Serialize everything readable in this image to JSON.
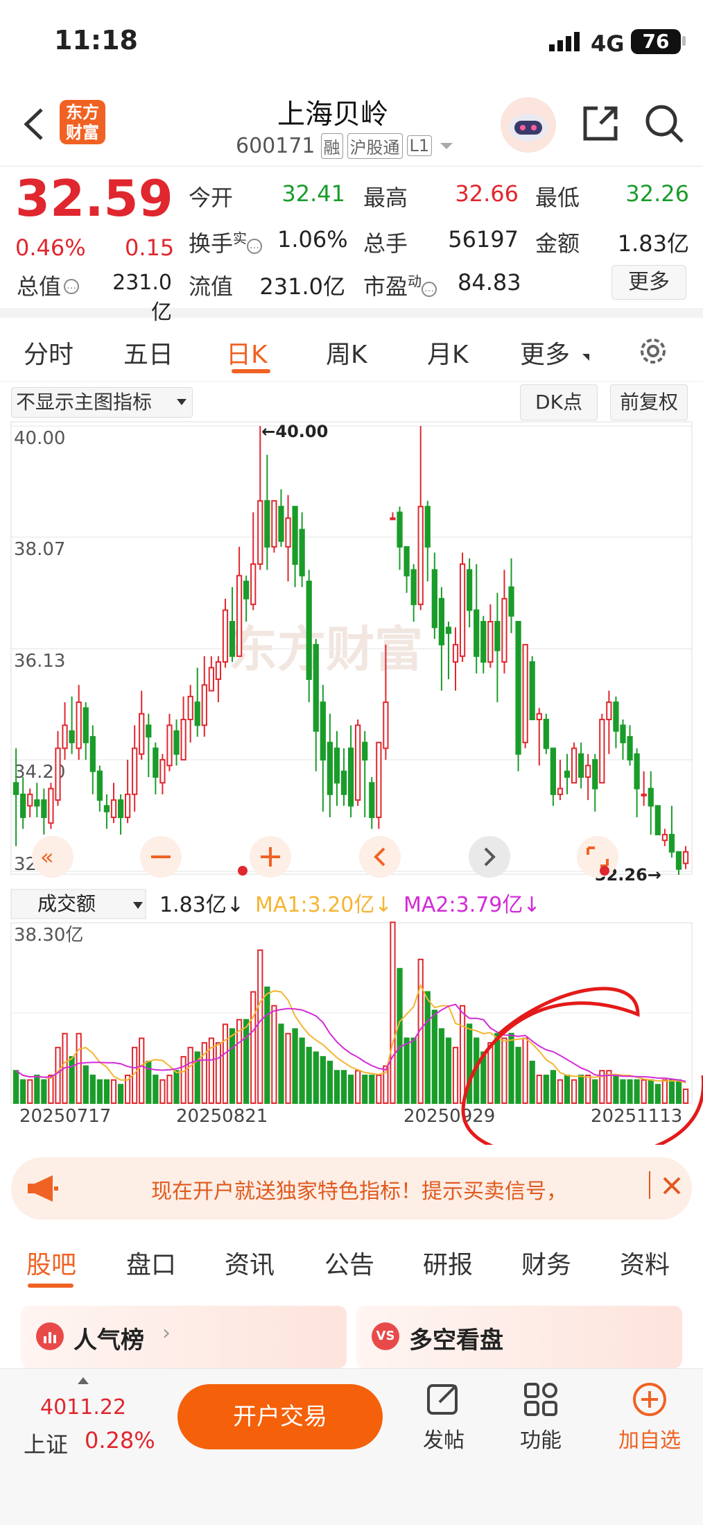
{
  "status": {
    "time": "11:18",
    "network": "4G",
    "battery": "76"
  },
  "header": {
    "title": "上海贝岭",
    "code": "600171",
    "tags": [
      "融",
      "沪股通",
      "L1"
    ],
    "logo_line1": "东方",
    "logo_line2": "财富"
  },
  "quote": {
    "price": "32.59",
    "change_pct": "0.46%",
    "change_amt": "0.15",
    "row1": [
      {
        "label": "今开",
        "value": "32.41",
        "color": "green"
      },
      {
        "label": "最高",
        "value": "32.66",
        "color": "red"
      },
      {
        "label": "最低",
        "value": "32.26",
        "color": "green"
      }
    ],
    "row2": [
      {
        "label": "换手",
        "sup": "实",
        "value": "1.06%"
      },
      {
        "label": "总手",
        "value": "56197"
      },
      {
        "label": "金额",
        "value": "1.83亿"
      }
    ],
    "row3": [
      {
        "label": "总值",
        "value": "231.0亿"
      },
      {
        "label": "流值",
        "value": "231.0亿"
      },
      {
        "label": "市盈",
        "sup": "动",
        "value": "84.83"
      }
    ],
    "more_label": "更多"
  },
  "period_tabs": [
    "分时",
    "五日",
    "日K",
    "周K",
    "月K",
    "更多"
  ],
  "active_period": "日K",
  "chart_toolbar": {
    "indicator_select": "不显示主图指标",
    "dk_label": "DK点",
    "adjust_label": "前复权"
  },
  "kline": {
    "y_labels": [
      "40.00",
      "38.07",
      "36.13",
      "34.20",
      "32.26"
    ],
    "high_annot": "←40.00",
    "low_annot": "32.26→",
    "watermark": "东方财富"
  },
  "volume": {
    "selector": "成交额",
    "current": "1.83亿↓",
    "ma1": "MA1:3.20亿↓",
    "ma2": "MA2:3.79亿↓",
    "y_max": "38.30亿"
  },
  "x_dates": [
    "20250717",
    "20250821",
    "20250929",
    "20251113"
  ],
  "chart_data": {
    "type": "candlestick",
    "ylim": [
      32.26,
      40.0
    ],
    "volume_ylim": [
      0,
      38.3
    ],
    "candles": [
      [
        33.8,
        33.6,
        34.4,
        32.7
      ],
      [
        33.6,
        33.2,
        33.9,
        33.0
      ],
      [
        33.4,
        33.6,
        33.7,
        33.2
      ],
      [
        33.5,
        33.4,
        33.8,
        33.2
      ],
      [
        33.5,
        33.2,
        33.7,
        32.9
      ],
      [
        33.1,
        33.7,
        33.8,
        33.0
      ],
      [
        33.5,
        34.4,
        34.7,
        33.4
      ],
      [
        34.4,
        34.8,
        35.2,
        34.2
      ],
      [
        34.7,
        34.5,
        35.3,
        34.3
      ],
      [
        34.4,
        35.2,
        35.5,
        34.2
      ],
      [
        35.1,
        34.5,
        35.2,
        34.2
      ],
      [
        34.6,
        34.0,
        34.8,
        33.6
      ],
      [
        34.0,
        33.5,
        34.1,
        33.3
      ],
      [
        33.4,
        33.3,
        33.6,
        33.0
      ],
      [
        33.2,
        33.5,
        33.8,
        33.1
      ],
      [
        33.5,
        33.2,
        33.6,
        32.9
      ],
      [
        33.2,
        33.6,
        34.2,
        33.1
      ],
      [
        33.6,
        34.4,
        34.8,
        33.3
      ],
      [
        34.3,
        35.0,
        35.4,
        34.2
      ],
      [
        34.8,
        34.6,
        35.0,
        33.9
      ],
      [
        34.4,
        33.9,
        34.5,
        33.6
      ],
      [
        33.8,
        34.2,
        34.3,
        33.6
      ],
      [
        34.1,
        34.8,
        35.0,
        34.0
      ],
      [
        34.7,
        34.3,
        34.9,
        34.1
      ],
      [
        34.2,
        34.9,
        35.3,
        34.2
      ],
      [
        34.9,
        35.3,
        35.5,
        34.5
      ],
      [
        35.2,
        34.8,
        35.8,
        34.6
      ],
      [
        34.8,
        35.5,
        36.0,
        34.6
      ],
      [
        35.4,
        35.8,
        36.0,
        35.5
      ],
      [
        35.6,
        35.9,
        36.0,
        35.2
      ],
      [
        35.9,
        36.8,
        37.0,
        35.8
      ],
      [
        36.6,
        36.0,
        37.2,
        35.9
      ],
      [
        36.0,
        37.4,
        37.9,
        36.0
      ],
      [
        37.3,
        37.0,
        37.4,
        36.6
      ],
      [
        36.9,
        37.6,
        38.5,
        36.8
      ],
      [
        37.6,
        38.7,
        40.0,
        37.5
      ],
      [
        38.7,
        37.9,
        39.5,
        37.5
      ],
      [
        37.9,
        38.7,
        38.7,
        37.8
      ],
      [
        38.6,
        38.0,
        38.9,
        37.9
      ],
      [
        37.9,
        38.4,
        38.8,
        37.3
      ],
      [
        38.6,
        37.6,
        38.6,
        37.2
      ],
      [
        38.2,
        37.4,
        38.5,
        37.2
      ],
      [
        37.3,
        35.6,
        37.5,
        35.2
      ],
      [
        36.2,
        34.7,
        36.3,
        34.0
      ],
      [
        35.2,
        34.2,
        35.5,
        33.3
      ],
      [
        34.5,
        33.6,
        35.0,
        33.2
      ],
      [
        34.4,
        33.8,
        34.7,
        33.4
      ],
      [
        34.0,
        33.6,
        34.4,
        33.4
      ],
      [
        34.4,
        33.4,
        34.8,
        33.2
      ],
      [
        33.5,
        34.8,
        34.9,
        33.4
      ],
      [
        34.5,
        34.2,
        34.7,
        33.2
      ],
      [
        33.8,
        33.2,
        33.9,
        33.0
      ],
      [
        33.2,
        34.5,
        34.5,
        33.0
      ],
      [
        34.4,
        35.2,
        36.2,
        34.2
      ],
      [
        38.4,
        38.4,
        38.5,
        38.4
      ],
      [
        38.5,
        37.9,
        38.6,
        37.5
      ],
      [
        37.9,
        37.4,
        37.9,
        37.1
      ],
      [
        37.5,
        36.9,
        37.6,
        36.6
      ],
      [
        36.9,
        38.6,
        40.0,
        36.8
      ],
      [
        38.6,
        37.9,
        38.7,
        37.3
      ],
      [
        37.5,
        36.5,
        37.8,
        36.3
      ],
      [
        37.0,
        36.2,
        37.2,
        35.4
      ],
      [
        36.5,
        36.4,
        36.6,
        35.6
      ],
      [
        35.9,
        36.2,
        36.5,
        35.4
      ],
      [
        36.0,
        37.6,
        37.8,
        35.9
      ],
      [
        37.5,
        36.8,
        37.7,
        36.5
      ],
      [
        36.8,
        36.0,
        37.6,
        35.7
      ],
      [
        36.6,
        35.9,
        36.7,
        35.7
      ],
      [
        35.9,
        36.6,
        36.9,
        35.8
      ],
      [
        36.6,
        36.1,
        37.1,
        35.2
      ],
      [
        35.9,
        37.0,
        37.5,
        35.7
      ],
      [
        37.2,
        36.7,
        37.7,
        36.4
      ],
      [
        36.6,
        34.3,
        36.6,
        34.0
      ],
      [
        34.5,
        36.2,
        36.2,
        34.4
      ],
      [
        35.9,
        34.9,
        36.0,
        34.9
      ],
      [
        34.9,
        35.0,
        35.1,
        34.1
      ],
      [
        34.9,
        34.4,
        35.0,
        34.3
      ],
      [
        34.4,
        33.6,
        34.4,
        33.4
      ],
      [
        33.6,
        33.7,
        34.2,
        33.5
      ],
      [
        34.0,
        33.9,
        34.3,
        33.6
      ],
      [
        33.8,
        34.4,
        34.5,
        33.8
      ],
      [
        34.3,
        33.9,
        34.5,
        33.7
      ],
      [
        33.9,
        34.1,
        34.3,
        33.5
      ],
      [
        34.2,
        33.7,
        34.3,
        33.3
      ],
      [
        33.8,
        34.9,
        35.0,
        33.8
      ],
      [
        34.9,
        35.2,
        35.4,
        34.3
      ],
      [
        35.2,
        34.7,
        35.3,
        34.4
      ],
      [
        34.8,
        34.5,
        34.9,
        34.2
      ],
      [
        34.6,
        34.2,
        34.8,
        34.1
      ],
      [
        34.3,
        33.7,
        34.4,
        33.2
      ],
      [
        33.6,
        33.6,
        34.0,
        33.4
      ],
      [
        33.7,
        33.4,
        34.0,
        32.9
      ],
      [
        33.4,
        32.9,
        33.4,
        32.9
      ],
      [
        32.8,
        32.9,
        33.0,
        32.7
      ],
      [
        32.9,
        32.6,
        33.4,
        32.5
      ],
      [
        32.6,
        32.3,
        32.6,
        32.2
      ],
      [
        32.4,
        32.6,
        32.7,
        32.3
      ]
    ],
    "volumes": [
      7,
      5,
      5,
      6,
      5,
      6,
      12,
      15,
      10,
      15,
      8,
      6,
      5,
      5,
      5,
      4,
      6,
      12,
      14,
      9,
      6,
      5,
      6,
      7,
      10,
      12,
      11,
      13,
      14,
      13,
      17,
      16,
      18,
      18,
      24,
      33,
      25,
      21,
      17,
      15,
      16,
      14,
      12,
      11,
      10,
      9,
      7,
      7,
      6,
      7,
      6,
      6,
      6,
      8,
      39,
      29,
      14,
      14,
      31,
      24,
      20,
      16,
      14,
      12,
      21,
      17,
      14,
      11,
      13,
      15,
      14,
      15,
      12,
      14,
      9,
      6,
      6,
      7,
      5,
      6,
      5,
      6,
      6,
      5,
      7,
      7,
      6,
      5,
      5,
      5,
      5,
      5,
      4,
      5,
      5,
      5,
      3
    ]
  }
}
